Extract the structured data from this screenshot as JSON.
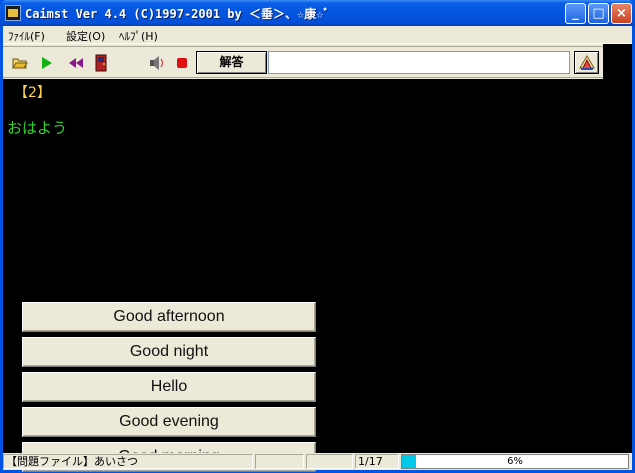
{
  "window": {
    "title": "Caimst Ver 4.4 (C)1997-2001  by ＜垂＞、☆康☆ﾞ"
  },
  "menu": [
    {
      "label": "ﾌｧｲﾙ(F)"
    },
    {
      "label": "設定(O)"
    },
    {
      "label": "ﾍﾙﾌﾟ(H)"
    }
  ],
  "toolbar": {
    "icons": [
      "open-folder-icon",
      "play-icon",
      "rewind-icon",
      "door-exit-icon",
      "speaker-icon",
      "record-icon",
      "help-book-icon"
    ],
    "answer_label": "解答",
    "answer_value": ""
  },
  "display": {
    "question_number": "【2】",
    "question_text": "おはよう",
    "choices": [
      "Good afternoon",
      "Good night",
      "Hello",
      "Good evening",
      "Good morning"
    ]
  },
  "status": {
    "problem_file": "【問題ファイル】あいさつ",
    "position": "1/17",
    "progress_text": "6%",
    "progress_value": 0.06
  },
  "colors": {
    "question_number": "#ffd24a",
    "question_text": "#2fd12f",
    "progress_fill": "#00c8e8"
  }
}
